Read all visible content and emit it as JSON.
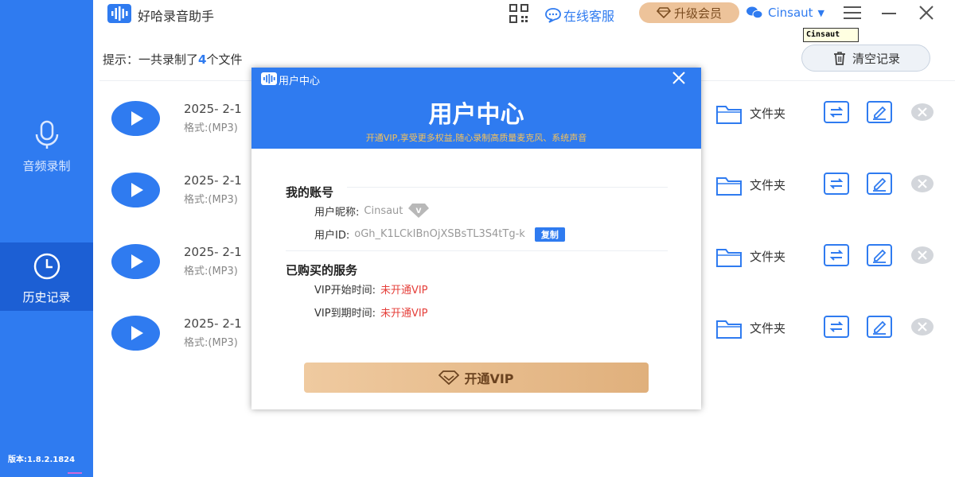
{
  "app": {
    "title": "好哈录音助手",
    "version": "版本:1.8.2.1824"
  },
  "sidebar": {
    "items": [
      {
        "label": "音频录制",
        "icon": "microphone-icon"
      },
      {
        "label": "历史记录",
        "icon": "clock-icon"
      }
    ]
  },
  "titlebar": {
    "customer_service": "在线客服",
    "upgrade": "升级会员",
    "username": "Cinsaut",
    "tooltip": "Cinsaut"
  },
  "content": {
    "hint_prefix": "提示：一共录制了",
    "hint_count": "4",
    "hint_suffix": "个文件",
    "clear_label": "清空记录",
    "rows": [
      {
        "date": "2025- 2-1",
        "format": "格式:(MP3)",
        "folder": "文件夹"
      },
      {
        "date": "2025- 2-1",
        "format": "格式:(MP3)",
        "folder": "文件夹"
      },
      {
        "date": "2025- 2-1",
        "format": "格式:(MP3)",
        "folder": "文件夹"
      },
      {
        "date": "2025- 2-1",
        "format": "格式:(MP3)",
        "folder": "文件夹"
      }
    ]
  },
  "modal": {
    "small_title": "用户中心",
    "title": "用户中心",
    "subtitle": "开通VIP,享受更多权益,随心录制高质量麦克风、系统声音",
    "account_section": "我的账号",
    "nickname_label": "用户昵称:",
    "nickname_value": "Cinsaut",
    "userid_label": "用户ID:",
    "userid_value": "oGh_K1LCkIBnOjXSBsTL3S4tTg-k",
    "copy_label": "复制",
    "service_section": "已购买的服务",
    "vip_start_label": "VIP开始时间:",
    "vip_start_value": "未开通VIP",
    "vip_end_label": "VIP到期时间:",
    "vip_end_value": "未开通VIP",
    "open_vip": "开通VIP"
  },
  "colors": {
    "brand": "#2f7bf0",
    "gold": "#edc39a",
    "red": "#e5403b"
  }
}
